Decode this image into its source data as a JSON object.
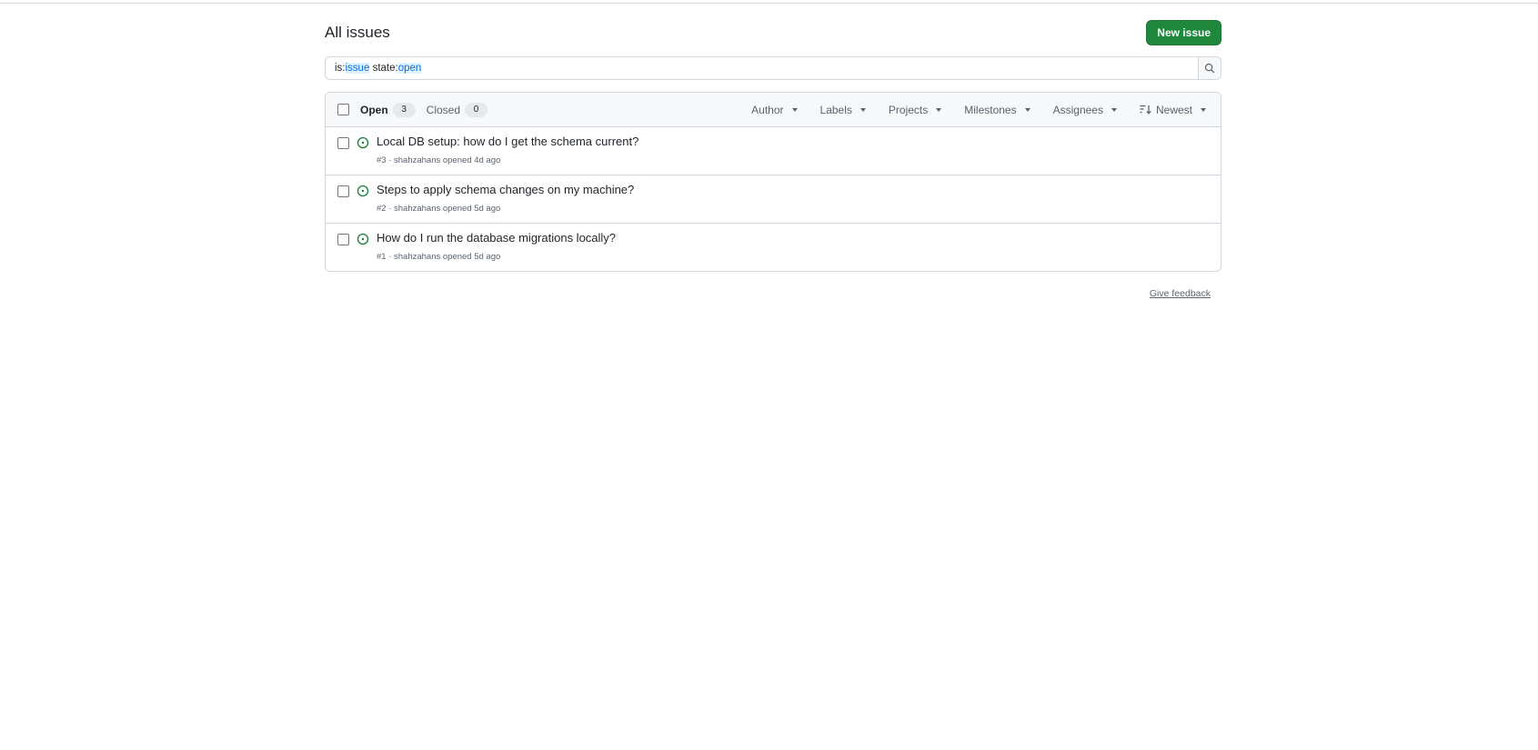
{
  "page": {
    "title": "All issues",
    "new_issue_label": "New issue"
  },
  "search": {
    "tokens": [
      {
        "key": "is:",
        "value": "issue"
      },
      {
        "key": "state:",
        "value": "open"
      }
    ],
    "icon": "search-icon"
  },
  "list_header": {
    "open_label": "Open",
    "open_count": "3",
    "closed_label": "Closed",
    "closed_count": "0",
    "filters": [
      "Author",
      "Labels",
      "Projects",
      "Milestones",
      "Assignees"
    ],
    "sort_label": "Newest"
  },
  "issues": [
    {
      "title": "Local DB setup: how do I get the schema current?",
      "meta": "#3 · shahzahans opened 4d ago"
    },
    {
      "title": "Steps to apply schema changes on my machine?",
      "meta": "#2 · shahzahans opened 5d ago"
    },
    {
      "title": "How do I run the database migrations locally?",
      "meta": "#1 · shahzahans opened 5d ago"
    }
  ],
  "footer": {
    "feedback_label": "Give feedback"
  },
  "colors": {
    "primary": "#1f883d",
    "open_icon": "#1a7f37",
    "accent": "#0969da"
  }
}
